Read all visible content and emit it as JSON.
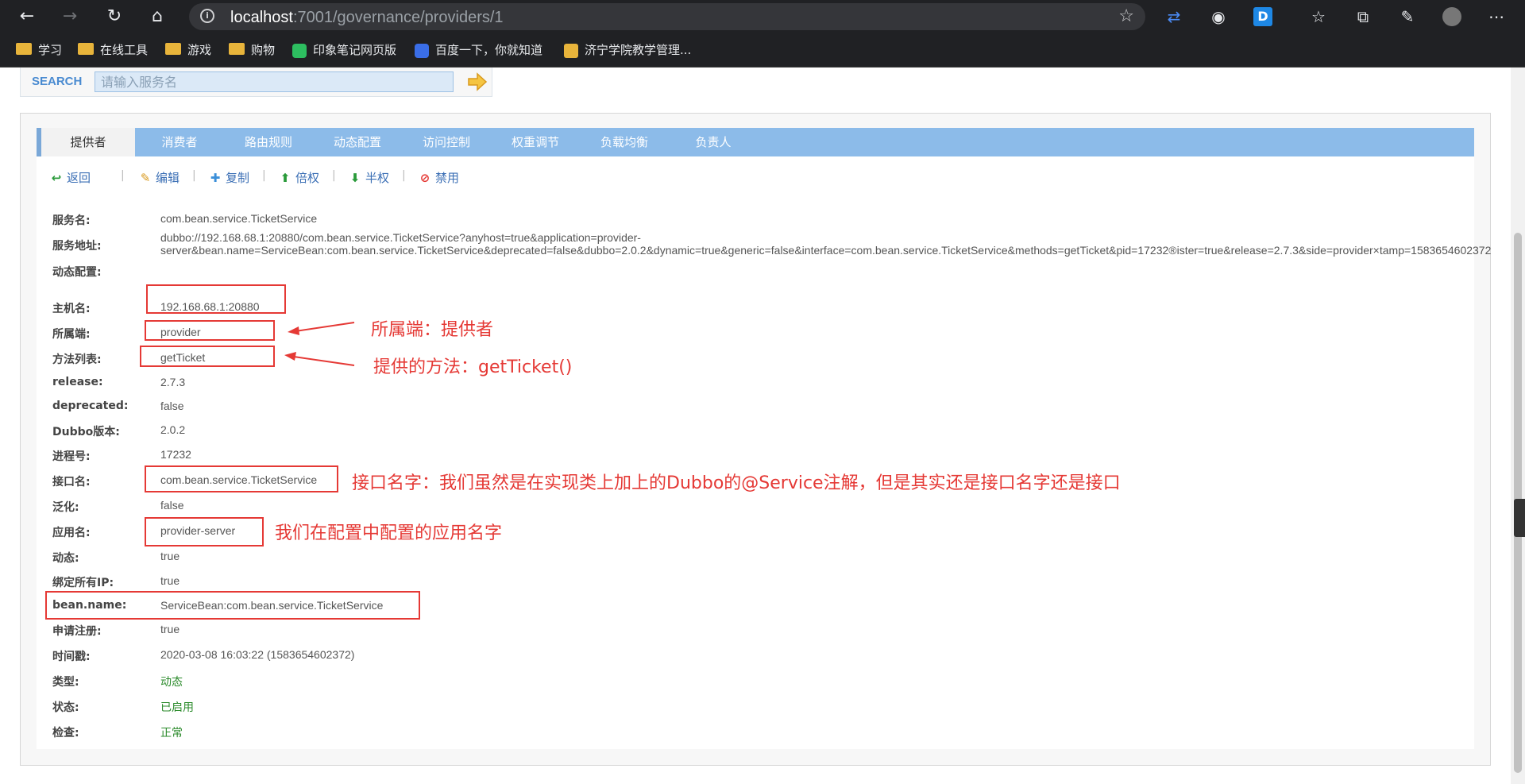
{
  "browser": {
    "url_host": "localhost",
    "url_path": ":7001/governance/providers/1",
    "bookmarks": [
      "学习",
      "在线工具",
      "游戏",
      "购物",
      "印象笔记网页版",
      "百度一下，你就知道",
      "济宁学院教学管理..."
    ]
  },
  "search": {
    "label": "SEARCH",
    "placeholder": "请输入服务名"
  },
  "tabs": [
    "提供者",
    "消费者",
    "路由规则",
    "动态配置",
    "访问控制",
    "权重调节",
    "负载均衡",
    "负责人"
  ],
  "actions": {
    "back": "返回",
    "edit": "编辑",
    "copy": "复制",
    "double": "倍权",
    "half": "半权",
    "disable": "禁用",
    "separator": "|"
  },
  "details": [
    {
      "label": "服务名:",
      "value": "com.bean.service.TicketService"
    },
    {
      "label": "服务地址:",
      "value": "dubbo://192.168.68.1:20880/com.bean.service.TicketService?anyhost=true&application=provider-server&bean.name=ServiceBean:com.bean.service.TicketService&deprecated=false&dubbo=2.0.2&dynamic=true&generic=false&interface=com.bean.service.TicketService&methods=getTicket&pid=17232®ister=true&release=2.7.3&side=provider×tamp=1583654602372"
    },
    {
      "label": "动态配置:",
      "value": ""
    },
    {
      "label": "主机名:",
      "value": "192.168.68.1:20880"
    },
    {
      "label": "所属端:",
      "value": "provider"
    },
    {
      "label": "方法列表:",
      "value": "getTicket"
    },
    {
      "label": "release:",
      "value": "2.7.3"
    },
    {
      "label": "deprecated:",
      "value": "false"
    },
    {
      "label": "Dubbo版本:",
      "value": "2.0.2"
    },
    {
      "label": "进程号:",
      "value": "17232"
    },
    {
      "label": "接口名:",
      "value": "com.bean.service.TicketService"
    },
    {
      "label": "泛化:",
      "value": "false"
    },
    {
      "label": "应用名:",
      "value": "provider-server"
    },
    {
      "label": "动态:",
      "value": "true"
    },
    {
      "label": "绑定所有IP:",
      "value": "true"
    },
    {
      "label": "bean.name:",
      "value": "ServiceBean:com.bean.service.TicketService"
    },
    {
      "label": "申请注册:",
      "value": "true"
    },
    {
      "label": "时间戳:",
      "value": "2020-03-08 16:03:22 (1583654602372)"
    },
    {
      "label": "类型:",
      "value": "动态"
    },
    {
      "label": "状态:",
      "value": "已启用"
    },
    {
      "label": "检查:",
      "value": "正常"
    }
  ],
  "annotations": {
    "side": "所属端：提供者",
    "method": "提供的方法：getTicket()",
    "interface": "接口名字：我们虽然是在实现类上加上的Dubbo的@Service注解，但是其实还是接口名字还是接口",
    "app": "我们在配置中配置的应用名字"
  },
  "colors": {
    "tab_bar": "#8cbbe9",
    "annotation_red": "#e53935",
    "link_blue": "#3b6fb5",
    "status_green": "#2a8a2a"
  }
}
